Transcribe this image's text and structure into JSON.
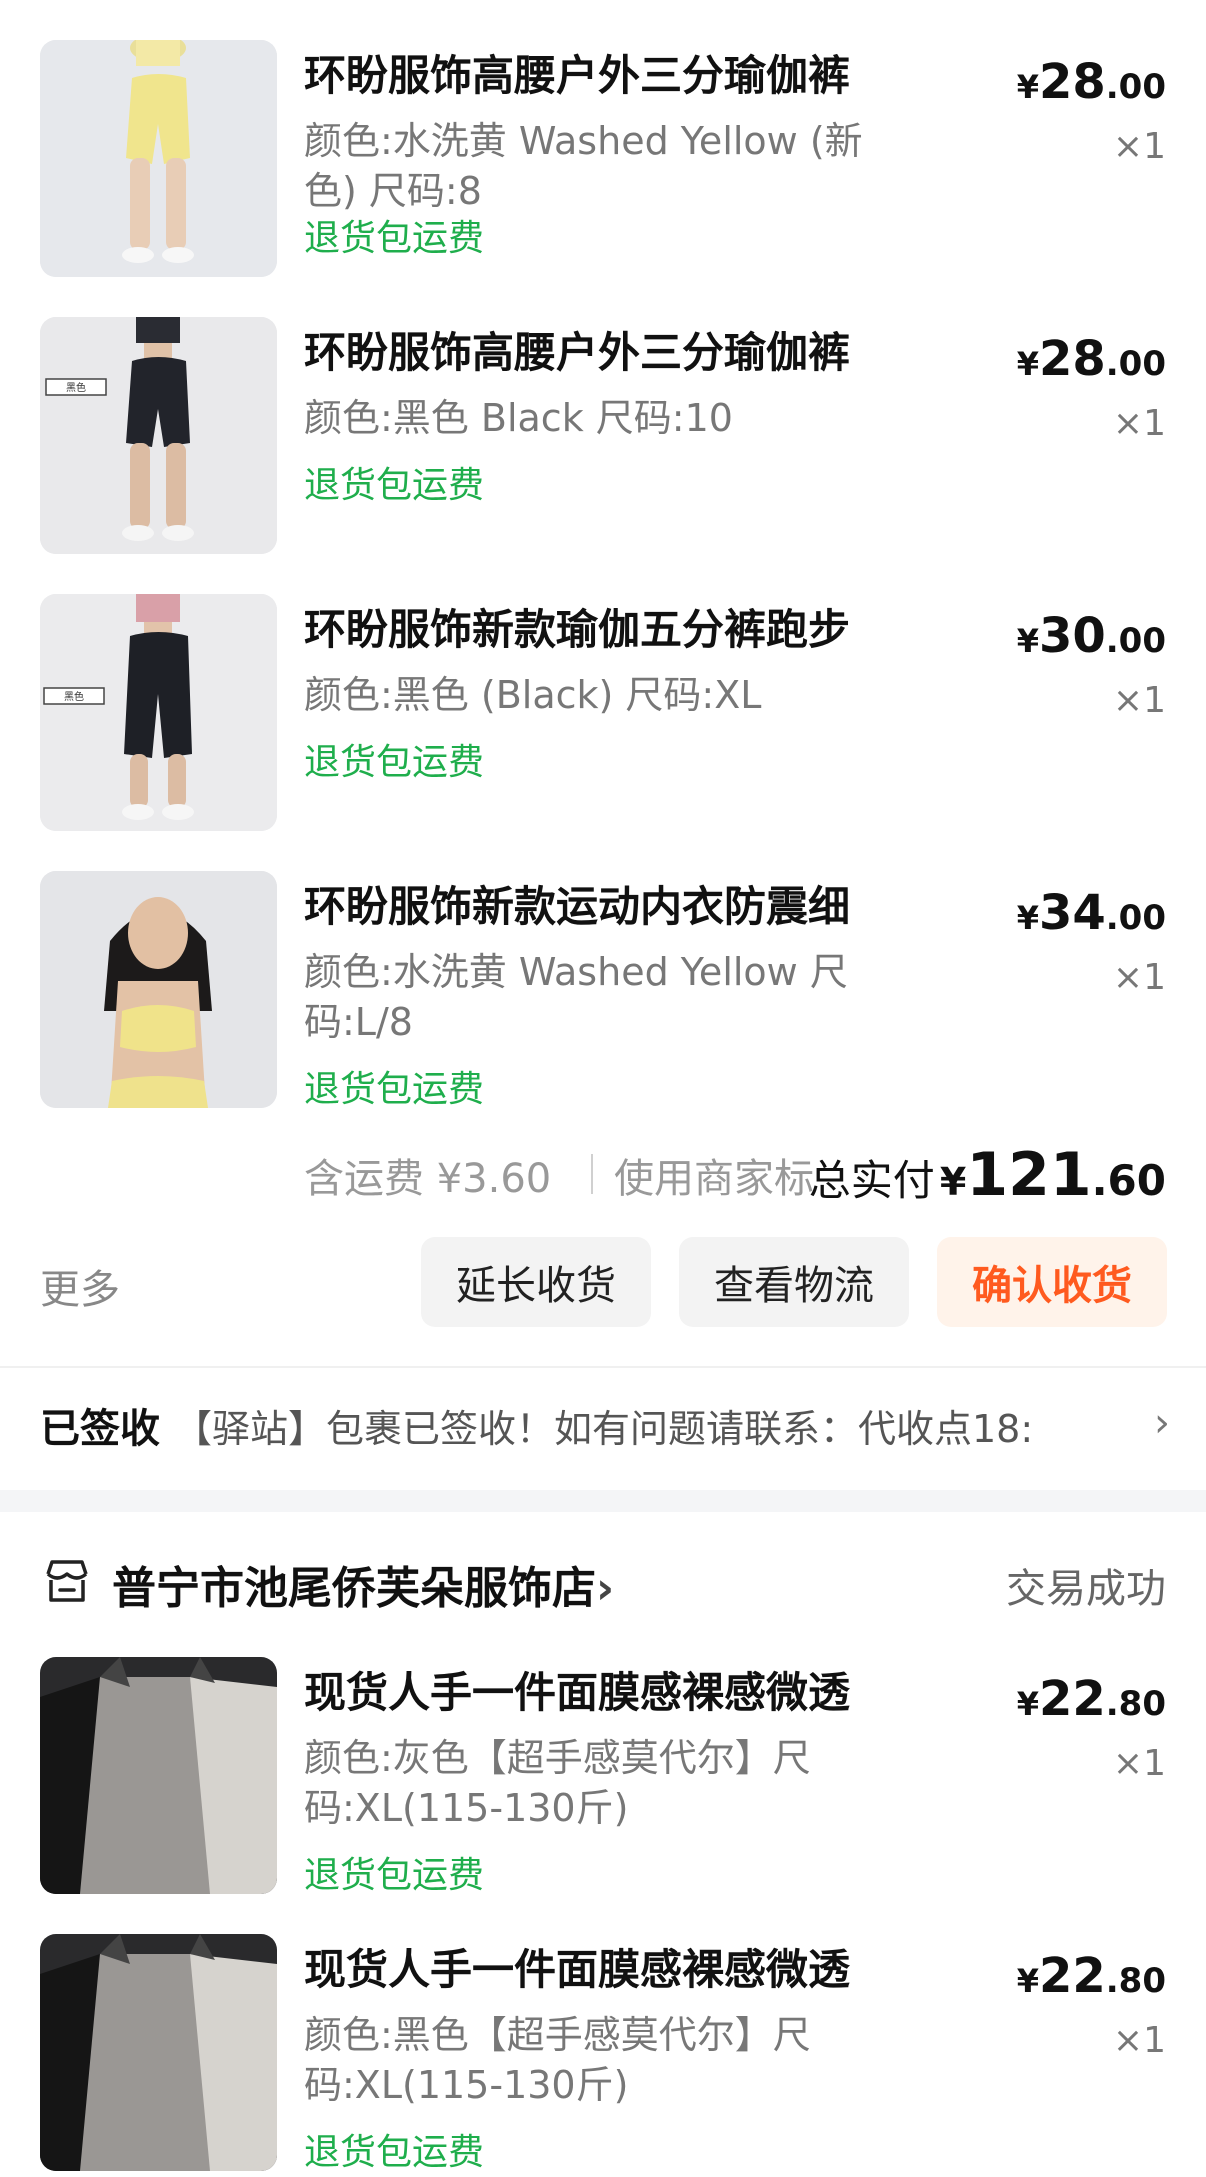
{
  "order1": {
    "products": [
      {
        "title": "环盼服饰高腰户外三分瑜伽裤",
        "spec": "颜色:水洗黄 Washed Yellow (新色) 尺码:8",
        "tag": "退货包运费",
        "price_currency": "¥",
        "price_int": "28",
        "price_dec": ".00",
        "qty": "×1",
        "image": "yellow-shorts-photo"
      },
      {
        "title": "环盼服饰高腰户外三分瑜伽裤",
        "spec": "颜色:黑色  Black 尺码:10",
        "tag": "退货包运费",
        "price_currency": "¥",
        "price_int": "28",
        "price_dec": ".00",
        "qty": "×1",
        "image": "black-shorts-photo",
        "image_label": "黑色"
      },
      {
        "title": "环盼服饰新款瑜伽五分裤跑步",
        "spec": "颜色:黑色 (Black) 尺码:XL",
        "tag": "退货包运费",
        "price_currency": "¥",
        "price_int": "30",
        "price_dec": ".00",
        "qty": "×1",
        "image": "black-five-point-pants-photo",
        "image_label": "黑色"
      },
      {
        "title": "环盼服饰新款运动内衣防震细",
        "spec": "颜色:水洗黄 Washed Yellow 尺码:L/8",
        "tag": "退货包运费",
        "price_currency": "¥",
        "price_int": "34",
        "price_dec": ".00",
        "qty": "×1",
        "image": "yellow-sports-bra-photo"
      }
    ],
    "summary": {
      "shipping": "含运费 ¥3.60",
      "merchant": "使用商家标",
      "total_label": "总实付",
      "total_currency": "¥",
      "total_int": "121",
      "total_dec": ".60"
    },
    "actions": {
      "more": "更多",
      "extend": "延长收货",
      "logistics": "查看物流",
      "confirm": "确认收货"
    },
    "logistics_status": {
      "status": "已签收",
      "message": "【驿站】包裹已签收！如有问题请联系：代收点18:"
    }
  },
  "order2": {
    "shop_name": "普宁市池尾侨芙朵服饰店",
    "shop_chevron": "›",
    "order_status": "交易成功",
    "products": [
      {
        "title": "现货人手一件面膜感裸感微透",
        "spec": "颜色:灰色【超手感莫代尔】尺码:XL(115-130斤)",
        "tag": "退货包运费",
        "price_currency": "¥",
        "price_int": "22",
        "price_dec": ".80",
        "qty": "×1",
        "image": "grey-tops-photo"
      },
      {
        "title": "现货人手一件面膜感裸感微透",
        "spec": "颜色:黑色【超手感莫代尔】尺码:XL(115-130斤)",
        "tag": "退货包运费",
        "price_currency": "¥",
        "price_int": "22",
        "price_dec": ".80",
        "qty": "×1",
        "image": "black-tops-photo"
      }
    ]
  },
  "colors": {
    "green_tag": "#1fae4c",
    "confirm_orange": "#ff5a1f"
  }
}
